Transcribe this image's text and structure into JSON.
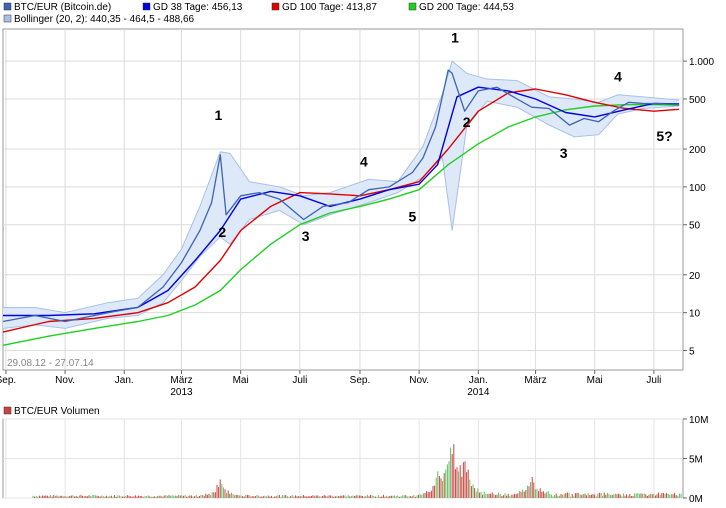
{
  "legend": {
    "row1": [
      {
        "label": "BTC/EUR (Bitcoin.de)",
        "color": "#3d64b4"
      },
      {
        "label": "GD 38 Tage: 456,13",
        "color": "#0000e0"
      },
      {
        "label": "GD 100 Tage: 413,87",
        "color": "#e00000"
      },
      {
        "label": "GD 200 Tage: 444,53",
        "color": "#20d020"
      }
    ],
    "row2": [
      {
        "label": "Bollinger (20, 2): 440,35 - 464,5 - 488,66",
        "color": "#a8c0e8"
      }
    ]
  },
  "date_range": "29.08.12 - 27.07.14",
  "volume_legend": {
    "label": "BTC/EUR Volumen",
    "color": "#d04040"
  },
  "chart_data": [
    {
      "type": "line",
      "scale": "log",
      "ylim": [
        3.5,
        1800
      ],
      "yticks": [
        {
          "v": 5,
          "label": "5"
        },
        {
          "v": 10,
          "label": "10"
        },
        {
          "v": 20,
          "label": "20"
        },
        {
          "v": 50,
          "label": "50"
        },
        {
          "v": 100,
          "label": "100"
        },
        {
          "v": 200,
          "label": "200"
        },
        {
          "v": 500,
          "label": "500"
        },
        {
          "v": 1000,
          "label": "1.000"
        }
      ],
      "xticks": [
        "Sep.",
        "Nov.",
        "Jan.",
        "März",
        "Mai",
        "Juli",
        "Sep.",
        "Nov.",
        "Jan.",
        "März",
        "Mai",
        "Juli"
      ],
      "year_labels": [
        {
          "label": "2013",
          "month": "Jan.",
          "index": 3
        },
        {
          "label": "2014",
          "month": "Jan.",
          "index": 8
        }
      ],
      "grid": true,
      "series": [
        {
          "name": "BTC/EUR (Bitcoin.de)",
          "color": "#3d64b4",
          "x": [
            "2012-08-29",
            "2012-10-01",
            "2012-11-01",
            "2012-12-15",
            "2013-01-15",
            "2013-02-10",
            "2013-03-01",
            "2013-03-20",
            "2013-04-01",
            "2013-04-10",
            "2013-04-16",
            "2013-05-01",
            "2013-05-20",
            "2013-06-10",
            "2013-07-05",
            "2013-07-25",
            "2013-08-20",
            "2013-09-10",
            "2013-10-01",
            "2013-10-25",
            "2013-11-05",
            "2013-11-18",
            "2013-12-01",
            "2013-12-05",
            "2013-12-18",
            "2014-01-01",
            "2014-01-20",
            "2014-02-10",
            "2014-02-25",
            "2014-03-15",
            "2014-04-05",
            "2014-04-20",
            "2014-05-05",
            "2014-05-20",
            "2014-06-05",
            "2014-06-20",
            "2014-07-05",
            "2014-07-27"
          ],
          "y": [
            8.5,
            9.5,
            8.5,
            10,
            11,
            16,
            25,
            45,
            75,
            180,
            60,
            85,
            90,
            80,
            55,
            70,
            75,
            95,
            100,
            130,
            170,
            300,
            850,
            800,
            400,
            580,
            620,
            500,
            430,
            420,
            310,
            350,
            330,
            400,
            470,
            460,
            460,
            450
          ]
        },
        {
          "name": "GD 38 Tage: 456,13",
          "color": "#0000e0",
          "x": [
            "2012-08-29",
            "2012-10-15",
            "2012-12-01",
            "2013-01-15",
            "2013-02-15",
            "2013-03-15",
            "2013-04-10",
            "2013-05-01",
            "2013-06-01",
            "2013-07-01",
            "2013-08-01",
            "2013-09-01",
            "2013-10-01",
            "2013-11-01",
            "2013-11-20",
            "2013-12-10",
            "2014-01-01",
            "2014-02-01",
            "2014-03-01",
            "2014-04-01",
            "2014-05-01",
            "2014-06-01",
            "2014-07-01",
            "2014-07-27"
          ],
          "y": [
            9.5,
            9.5,
            9.8,
            11,
            15,
            26,
            45,
            80,
            92,
            85,
            70,
            80,
            95,
            105,
            150,
            520,
            620,
            580,
            500,
            390,
            360,
            410,
            460,
            456
          ]
        },
        {
          "name": "GD 100 Tage: 413,87",
          "color": "#e00000",
          "x": [
            "2012-08-29",
            "2012-10-15",
            "2012-12-01",
            "2013-01-15",
            "2013-02-15",
            "2013-03-15",
            "2013-04-10",
            "2013-05-01",
            "2013-06-01",
            "2013-07-01",
            "2013-08-01",
            "2013-09-01",
            "2013-10-01",
            "2013-11-01",
            "2013-12-01",
            "2014-01-01",
            "2014-02-01",
            "2014-03-01",
            "2014-04-01",
            "2014-05-01",
            "2014-06-01",
            "2014-07-01",
            "2014-07-27"
          ],
          "y": [
            7,
            8.5,
            9,
            10,
            12,
            16,
            26,
            45,
            70,
            90,
            88,
            85,
            95,
            110,
            200,
            400,
            560,
            600,
            540,
            470,
            420,
            400,
            414
          ]
        },
        {
          "name": "GD 200 Tage: 444,53",
          "color": "#20d020",
          "x": [
            "2012-08-29",
            "2012-10-15",
            "2012-12-01",
            "2013-01-15",
            "2013-02-15",
            "2013-03-15",
            "2013-04-10",
            "2013-05-01",
            "2013-06-01",
            "2013-07-01",
            "2013-08-01",
            "2013-09-01",
            "2013-10-01",
            "2013-11-01",
            "2013-12-01",
            "2014-01-01",
            "2014-02-01",
            "2014-03-01",
            "2014-04-01",
            "2014-05-01",
            "2014-06-01",
            "2014-07-01",
            "2014-07-27"
          ],
          "y": [
            5.5,
            6.5,
            7.5,
            8.5,
            9.5,
            11.5,
            15,
            22,
            35,
            50,
            62,
            70,
            80,
            95,
            150,
            220,
            300,
            360,
            410,
            440,
            450,
            452,
            445
          ]
        }
      ],
      "bollinger": {
        "name": "Bollinger (20, 2): 440,35 - 464,5 - 488,66",
        "color": "#a8c0e8",
        "x": [
          "2012-08-29",
          "2012-10-01",
          "2012-11-01",
          "2012-12-15",
          "2013-01-15",
          "2013-02-10",
          "2013-03-01",
          "2013-03-20",
          "2013-04-10",
          "2013-04-20",
          "2013-05-10",
          "2013-06-10",
          "2013-07-05",
          "2013-08-01",
          "2013-09-10",
          "2013-10-10",
          "2013-11-05",
          "2013-11-25",
          "2013-12-05",
          "2013-12-20",
          "2014-01-10",
          "2014-02-10",
          "2014-03-15",
          "2014-04-10",
          "2014-05-05",
          "2014-05-25",
          "2014-06-20",
          "2014-07-27"
        ],
        "upper": [
          11,
          11,
          10,
          12,
          13,
          20,
          32,
          70,
          190,
          185,
          110,
          100,
          85,
          90,
          115,
          110,
          210,
          550,
          1000,
          800,
          720,
          700,
          520,
          500,
          470,
          540,
          520,
          489
        ],
        "lower": [
          7.5,
          8,
          7.5,
          9,
          9.5,
          12,
          18,
          28,
          40,
          35,
          55,
          65,
          50,
          60,
          75,
          90,
          120,
          170,
          45,
          300,
          480,
          430,
          310,
          250,
          260,
          380,
          420,
          440
        ]
      },
      "annotations": [
        {
          "text": "1",
          "x": "2013-04-08",
          "y": 340
        },
        {
          "text": "2",
          "x": "2013-04-12",
          "y": 40
        },
        {
          "text": "3",
          "x": "2013-07-07",
          "y": 37
        },
        {
          "text": "4",
          "x": "2013-09-05",
          "y": 145
        },
        {
          "text": "5",
          "x": "2013-10-25",
          "y": 53
        },
        {
          "text": "1",
          "x": "2013-12-08",
          "y": 1400
        },
        {
          "text": "2",
          "x": "2013-12-20",
          "y": 300
        },
        {
          "text": "3",
          "x": "2014-03-30",
          "y": 170
        },
        {
          "text": "4",
          "x": "2014-05-25",
          "y": 690
        },
        {
          "text": "5?",
          "x": "2014-07-12",
          "y": 232
        }
      ]
    },
    {
      "type": "bar",
      "title": "BTC/EUR Volumen",
      "ylim": [
        0,
        10000000
      ],
      "yticks": [
        {
          "v": 0,
          "label": "0M"
        },
        {
          "v": 5000000,
          "label": "5M"
        },
        {
          "v": 10000000,
          "label": "10M"
        }
      ],
      "peaks": [
        {
          "x": "2013-04-10",
          "value": 2600000
        },
        {
          "x": "2013-11-20",
          "value": 3500000
        },
        {
          "x": "2013-12-05",
          "value": 8500000
        },
        {
          "x": "2013-12-18",
          "value": 6000000
        },
        {
          "x": "2014-02-25",
          "value": 2500000
        }
      ]
    }
  ]
}
